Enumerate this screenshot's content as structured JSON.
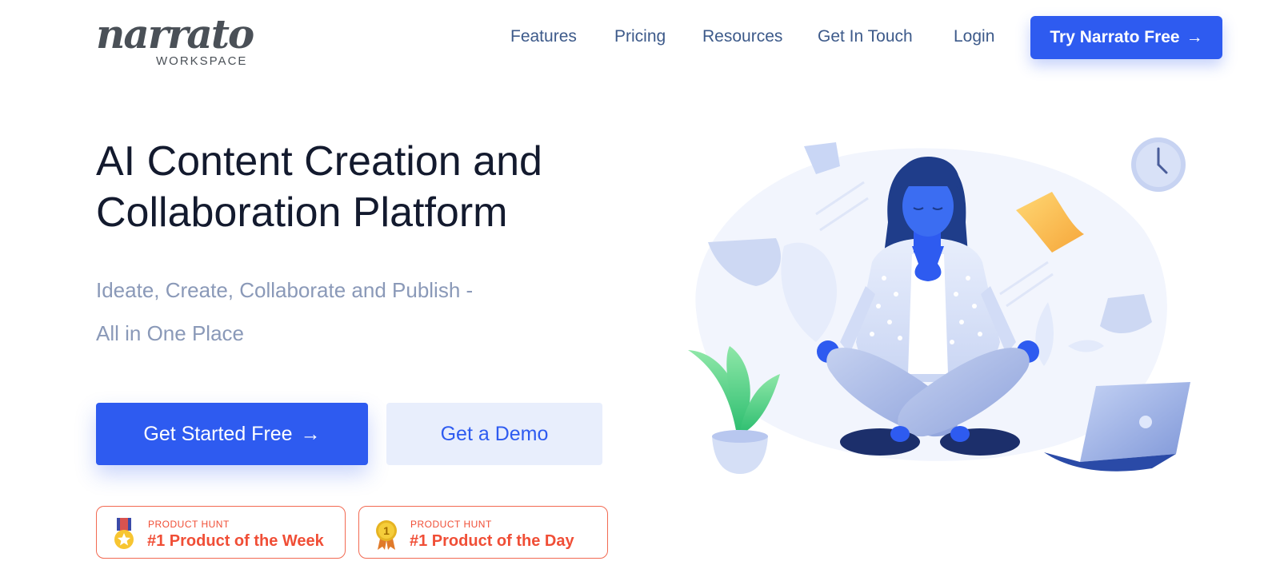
{
  "brand": {
    "logo_script": "narrato",
    "logo_sub": "WORKSPACE"
  },
  "nav": {
    "links": [
      "Features",
      "Pricing",
      "Resources",
      "Get In Touch",
      "Login"
    ],
    "cta_label": "Try Narrato Free",
    "cta_icon": "arrow-right-icon"
  },
  "hero": {
    "title_line1": "AI Content Creation and",
    "title_line2": "Collaboration Platform",
    "subtitle_line1": "Ideate, Create, Collaborate and Publish -",
    "subtitle_line2": "All in One Place",
    "primary_cta": "Get Started Free",
    "secondary_cta": "Get a Demo"
  },
  "badges": [
    {
      "kicker": "PRODUCT HUNT",
      "title": "#1 Product of the Week",
      "icon": "medal-star-icon"
    },
    {
      "kicker": "PRODUCT HUNT",
      "title": "#1 Product of the Day",
      "icon": "medal-number-one-icon",
      "icon_text": "1"
    }
  ],
  "colors": {
    "primary": "#2e5bf0",
    "secondary_bg": "#e8eefc",
    "nav_text": "#3d5a8a",
    "subtitle_text": "#8a99b8",
    "badge_accent": "#f04e36"
  }
}
